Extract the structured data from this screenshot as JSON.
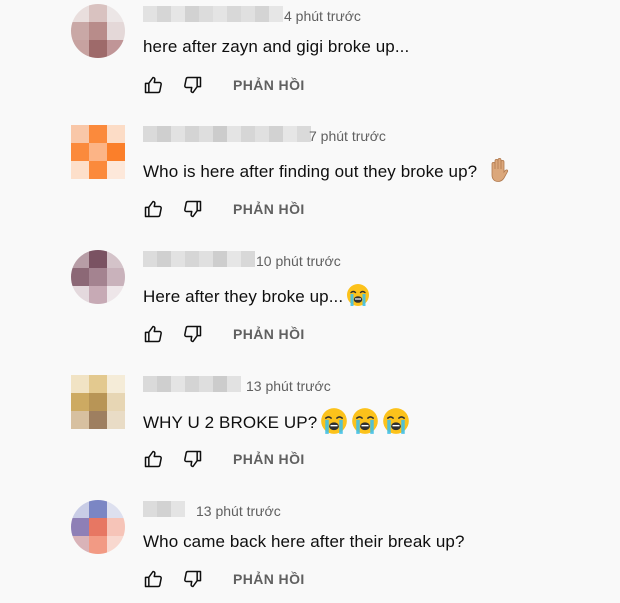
{
  "comments": [
    {
      "time": "4 phút trước",
      "text": "here after zayn and gigi broke up...",
      "reply_label": "PHẢN HỒI",
      "emoji": []
    },
    {
      "time": "7 phút trước",
      "text": "Who is here after finding out they broke up?",
      "reply_label": "PHẢN HỒI",
      "emoji": [
        "raised-hand-emoji"
      ]
    },
    {
      "time": "10 phút trước",
      "text": "Here after they broke up...",
      "reply_label": "PHẢN HỒI",
      "emoji": [
        "loudly-crying-face-emoji"
      ]
    },
    {
      "time": "13 phút trước",
      "text": "WHY U 2 BROKE UP?",
      "reply_label": "PHẢN HỒI",
      "emoji": [
        "loudly-crying-face-emoji",
        "loudly-crying-face-emoji",
        "loudly-crying-face-emoji"
      ]
    },
    {
      "time": "13 phút trước",
      "text": "Who came back here after their break up?",
      "reply_label": "PHẢN HỒI",
      "emoji": []
    }
  ],
  "icons": {
    "like": "thumbs-up-icon",
    "dislike": "thumbs-down-icon"
  },
  "colors": {
    "background": "#f9f9f9",
    "text": "#0f0f0f",
    "secondary": "#606060"
  }
}
